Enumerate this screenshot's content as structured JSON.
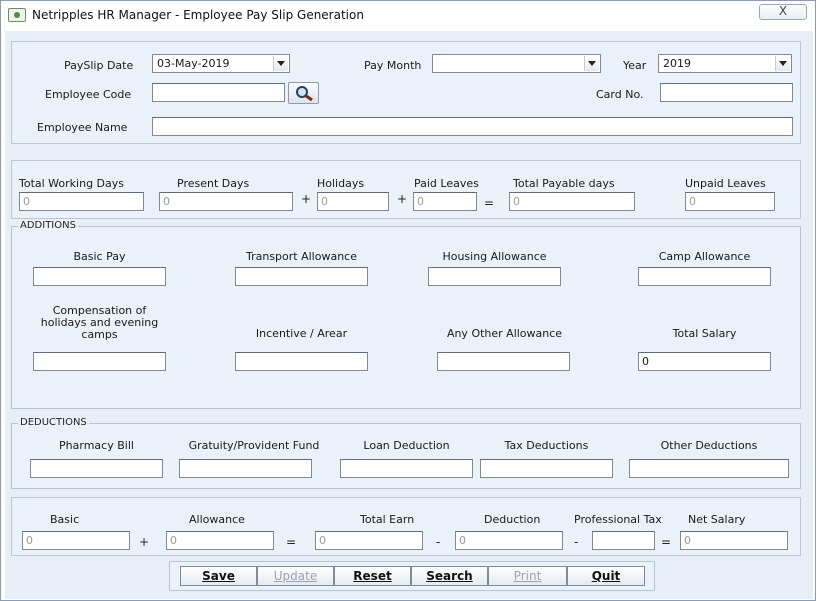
{
  "window": {
    "title": "Netripples HR Manager - Employee Pay Slip Generation",
    "close_glyph": "X"
  },
  "header": {
    "payslip_date_label": "PaySlip Date",
    "payslip_date_value": "03-May-2019",
    "pay_month_label": "Pay Month",
    "pay_month_value": "",
    "year_label": "Year",
    "year_value": "2019",
    "employee_code_label": "Employee Code",
    "employee_code_value": "",
    "card_no_label": "Card No.",
    "card_no_value": "",
    "employee_name_label": "Employee Name",
    "employee_name_value": ""
  },
  "attendance": {
    "total_working_days_label": "Total Working Days",
    "total_working_days_value": "0",
    "present_days_label": "Present Days",
    "present_days_value": "0",
    "holidays_label": "Holidays",
    "holidays_value": "0",
    "paid_leaves_label": "Paid Leaves",
    "paid_leaves_value": "0",
    "total_payable_days_label": "Total Payable days",
    "total_payable_days_value": "0",
    "unpaid_leaves_label": "Unpaid Leaves",
    "unpaid_leaves_value": "0",
    "plus_sign": "+",
    "equals_sign": "="
  },
  "additions": {
    "legend": "ADDITIONS",
    "basic_pay_label": "Basic Pay",
    "transport_label": "Transport Allowance",
    "housing_label": "Housing Allowance",
    "camp_label": "Camp Allowance",
    "compensation_label": "Compensation of holidays and evening camps",
    "incentive_label": "Incentive / Arear",
    "other_allowance_label": "Any Other Allowance",
    "total_salary_label": "Total Salary",
    "total_salary_value": "0"
  },
  "deductions": {
    "legend": "DEDUCTIONS",
    "pharmacy_label": "Pharmacy Bill",
    "gratuity_label": "Gratuity/Provident Fund",
    "loan_label": "Loan Deduction",
    "tax_label": "Tax Deductions",
    "other_label": "Other Deductions"
  },
  "summary": {
    "basic_label": "Basic",
    "basic_value": "0",
    "allowance_label": "Allowance",
    "allowance_value": "0",
    "total_earn_label": "Total Earn",
    "total_earn_value": "0",
    "deduction_label": "Deduction",
    "deduction_value": "0",
    "professional_tax_label": "Professional Tax",
    "professional_tax_value": "",
    "net_salary_label": "Net Salary",
    "net_salary_value": "0",
    "plus_sign": "+",
    "equals_sign": "=",
    "minus_sign": "-"
  },
  "buttons": {
    "save": "Save",
    "update": "Update",
    "reset": "Reset",
    "search": "Search",
    "print": "Print",
    "quit": "Quit"
  }
}
